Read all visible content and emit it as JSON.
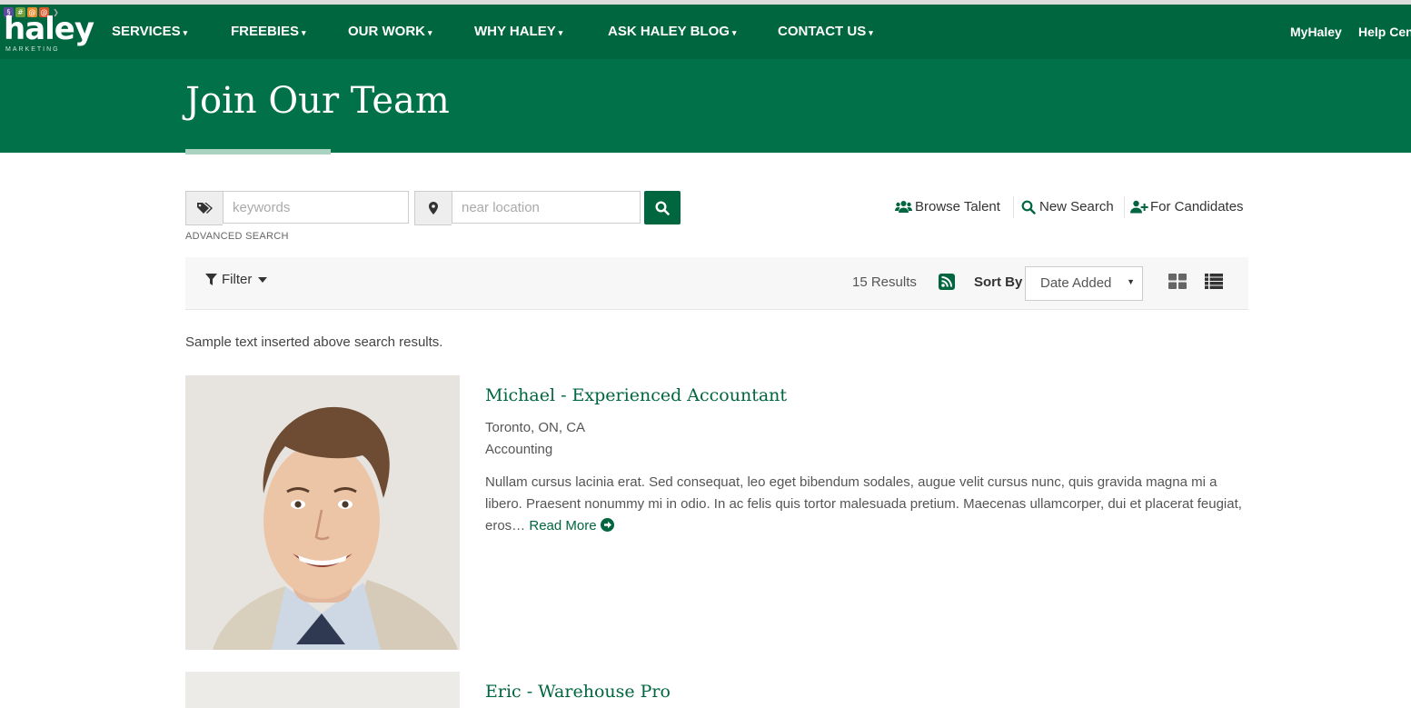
{
  "brand": {
    "logo_text": "haley",
    "logo_sub": "MARKETING",
    "logo_symbols": [
      "§",
      "#",
      "@",
      "@",
      "❯"
    ],
    "accent_color": "#00663f",
    "header_color": "#007149"
  },
  "nav": {
    "items": [
      {
        "label": "SERVICES"
      },
      {
        "label": "FREEBIES"
      },
      {
        "label": "OUR WORK"
      },
      {
        "label": "WHY HALEY"
      },
      {
        "label": "ASK HALEY BLOG"
      },
      {
        "label": "CONTACT US"
      }
    ],
    "right": [
      "MyHaley",
      "Help Cen"
    ]
  },
  "page": {
    "title": "Join Our Team"
  },
  "search": {
    "keywords_placeholder": "keywords",
    "location_placeholder": "near location",
    "advanced_label": "ADVANCED SEARCH",
    "tag_icon": "tags-icon",
    "location_icon": "map-marker-icon",
    "submit_icon": "search-icon"
  },
  "quick_links": [
    {
      "label": "Browse Talent",
      "icon": "users-icon"
    },
    {
      "label": "New Search",
      "icon": "search-icon"
    },
    {
      "label": "For Candidates",
      "icon": "user-plus-icon"
    }
  ],
  "toolbar": {
    "filter_label": "Filter",
    "results_text": "15 Results",
    "sort_label": "Sort By",
    "sort_value": "Date Added",
    "view_icons": [
      "grid-view-icon",
      "list-view-icon"
    ]
  },
  "sample_text": "Sample text inserted above search results.",
  "results": [
    {
      "title": "Michael - Experienced Accountant",
      "location": "Toronto, ON, CA",
      "category": "Accounting",
      "description": "Nullam cursus lacinia erat. Sed consequat, leo eget bibendum sodales, augue velit cursus nunc, quis gravida magna mi a libero. Praesent nonummy mi in odio. In ac felis quis tortor malesuada pretium. Maecenas ullamcorper, dui et placerat feugiat, eros…",
      "read_more": "Read More"
    },
    {
      "title": "Eric - Warehouse Pro"
    }
  ]
}
